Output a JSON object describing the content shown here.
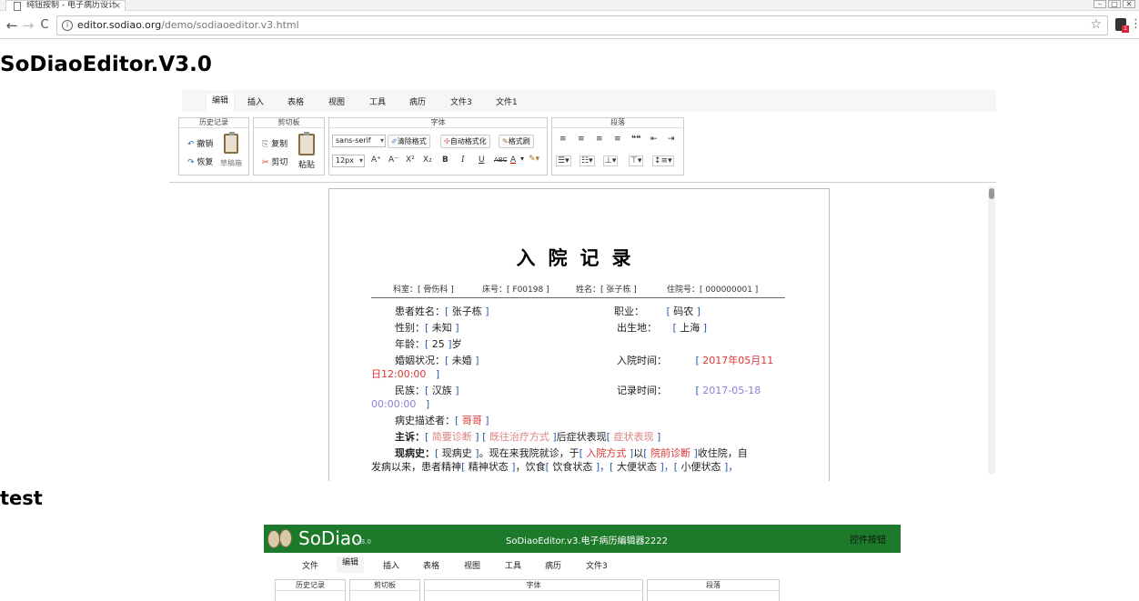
{
  "browser": {
    "tab_title": "纯钮按制 - 电子病历设计",
    "tab_close": "×",
    "url_host": "editor.sodiao.org",
    "url_path": "/demo/sodiaoeditor.v3.html",
    "back": "←",
    "forward": "→",
    "reload": "C",
    "star": "☆",
    "menu": "⋮"
  },
  "page": {
    "title": "SoDiaoEditor.V3.0",
    "test_heading": "test"
  },
  "editor1": {
    "menu": [
      "编辑",
      "插入",
      "表格",
      "视图",
      "工具",
      "病历",
      "文件3",
      "文件1"
    ],
    "groups": {
      "history": {
        "title": "历史记录",
        "undo": "撤销",
        "redo": "恢复",
        "draft": "草稿箱"
      },
      "clipboard": {
        "title": "剪切板",
        "copy": "复制",
        "cut": "剪切",
        "paste": "粘贴"
      },
      "font": {
        "title": "字体",
        "font_family": "sans-serif",
        "font_size": "12px",
        "clear_format": "清除格式",
        "auto_format": "自动格式化",
        "format_painter": "格式刷"
      },
      "paragraph": {
        "title": "段落"
      }
    },
    "font_glyphs": [
      "A⁺",
      "A⁻",
      "X²",
      "X₂",
      "B",
      "I",
      "U",
      "ABC",
      "A"
    ],
    "para_glyphs": [
      "≡",
      "≡",
      "≡",
      "≡",
      "❝❝",
      "⇤",
      "⇥"
    ]
  },
  "document": {
    "title": "入院记录",
    "meta": {
      "dept_label": "科室：",
      "dept_value": "[ 骨伤科 ]",
      "bed_label": "床号：",
      "bed_value": "[ F00198 ]",
      "name_label": "姓名：",
      "name_value": "[ 张子栋 ]",
      "inpatient_label": "住院号：",
      "inpatient_value": "[ 000000001 ]"
    },
    "fields": {
      "patient_name_label": "患者姓名：",
      "patient_name": "张子栋",
      "job_label": "职业：",
      "job": "码农",
      "gender_label": "性别：",
      "gender": "未知",
      "birthplace_label": "出生地：",
      "birthplace": "上海",
      "age_label": "年龄：",
      "age": "25",
      "age_unit": "岁",
      "marital_label": "婚姻状况：",
      "marital": "未婚",
      "admit_time_label": "入院时间：",
      "admit_time_a": "2017年05月11",
      "admit_time_b": "日12:00:00",
      "ethnicity_label": "民族：",
      "ethnicity": "汉族",
      "record_time_label": "记录时间：",
      "record_time_a": "2017-05-18",
      "record_time_b": "00:00:00",
      "history_narrator_label": "病史描述者：",
      "history_narrator": "哥哥",
      "chief_label": "主诉：",
      "chief_brief": "简要诊断",
      "chief_prev": "既往治疗方式",
      "chief_after": "后症状表现",
      "chief_symptom": "症状表现",
      "present_label": "现病史：",
      "present_value": "现病史",
      "present_text1": "。现在来我院就诊，于",
      "present_admit": "入院方式",
      "present_by": "以",
      "present_prev_diag": "院前诊断",
      "present_text2": "收住院，自",
      "line2_a": "发病以来，患者精神",
      "spirit": "精神状态",
      "line2_b": "，饮食",
      "diet": "饮食状态",
      "stool": "大便状态",
      "urine": "小便状态"
    }
  },
  "editor2": {
    "logo": "SoDiao",
    "version": "V3.0",
    "header_title": "SoDiaoEditor.v3.电子病历编辑器2222",
    "header_control": "控件按钮",
    "menu": [
      "文件",
      "编辑",
      "插入",
      "表格",
      "视图",
      "工具",
      "病历",
      "文件3"
    ],
    "groups": [
      "历史记录",
      "剪切板",
      "字体",
      "段落"
    ]
  },
  "colors": {
    "bracket": "#2a5caa",
    "red_field": "#d33",
    "pink_field": "#e08080",
    "purple_field": "#8a7fd6",
    "header_green": "#1d7a2a"
  }
}
